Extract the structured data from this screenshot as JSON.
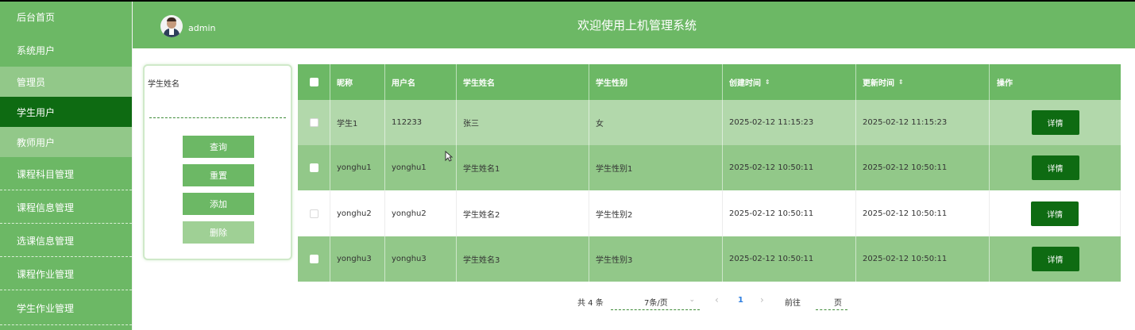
{
  "sidebar": {
    "items": [
      {
        "label": "后台首页"
      },
      {
        "label": "系统用户"
      },
      {
        "label": "管理员"
      },
      {
        "label": "学生用户"
      },
      {
        "label": "教师用户"
      },
      {
        "label": "课程科目管理"
      },
      {
        "label": "课程信息管理"
      },
      {
        "label": "选课信息管理"
      },
      {
        "label": "课程作业管理"
      },
      {
        "label": "学生作业管理"
      }
    ]
  },
  "header": {
    "username": "admin",
    "title": "欢迎使用上机管理系统"
  },
  "search": {
    "label": "学生姓名",
    "value": "",
    "placeholder": "",
    "buttons": {
      "query": "查询",
      "reset": "重置",
      "add": "添加",
      "delete": "删除"
    }
  },
  "table": {
    "columns": [
      "昵称",
      "用户名",
      "学生姓名",
      "学生性别",
      "创建时间",
      "更新时间",
      "操作"
    ],
    "sort_icon": "⇕",
    "detail_label": "详情",
    "rows": [
      [
        "学生1",
        "112233",
        "张三",
        "女",
        "2025-02-12 11:15:23",
        "2025-02-12 11:15:23"
      ],
      [
        "yonghu1",
        "yonghu1",
        "学生姓名1",
        "学生性别1",
        "2025-02-12 10:50:11",
        "2025-02-12 10:50:11"
      ],
      [
        "yonghu2",
        "yonghu2",
        "学生姓名2",
        "学生性别2",
        "2025-02-12 10:50:11",
        "2025-02-12 10:50:11"
      ],
      [
        "yonghu3",
        "yonghu3",
        "学生姓名3",
        "学生性别3",
        "2025-02-12 10:50:11",
        "2025-02-12 10:50:11"
      ]
    ]
  },
  "pagination": {
    "total": "共 4 条",
    "page_size": "7条/页",
    "prev": "‹",
    "current": "1",
    "next": "›",
    "goto": "前往",
    "page_unit": "页"
  },
  "colors": {
    "primary": "#6cb865",
    "dark": "#0e6b12",
    "row_light": "#b2d8ab",
    "row_mid": "#92c889"
  }
}
